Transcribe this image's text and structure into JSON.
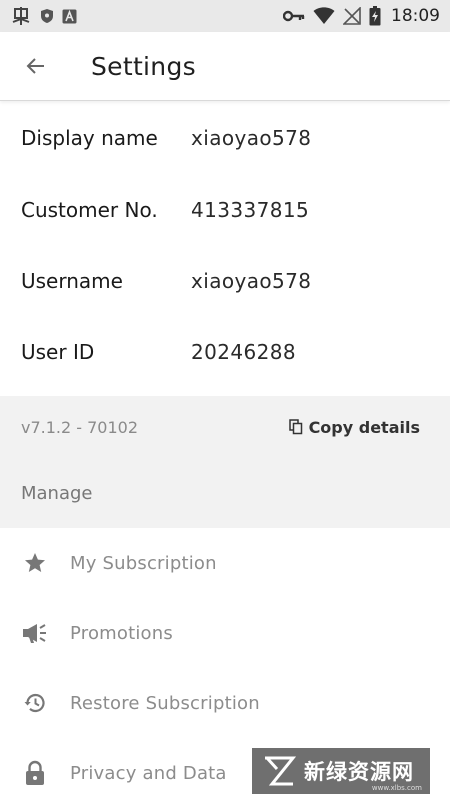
{
  "status_bar": {
    "time": "18:09",
    "icons": [
      "debug-bug-icon",
      "shield-icon",
      "a-letter-icon",
      "key-icon",
      "wifi-icon",
      "no-signal-icon",
      "battery-charging-icon"
    ]
  },
  "app_bar": {
    "back_icon": "arrow-left-icon",
    "title": "Settings"
  },
  "account": [
    {
      "label": "Display name",
      "value": "xiaoyao578"
    },
    {
      "label": "Customer No.",
      "value": "413337815"
    },
    {
      "label": "Username",
      "value": "xiaoyao578"
    },
    {
      "label": "User ID",
      "value": "20246288"
    }
  ],
  "version": {
    "text": "v7.1.2 - 70102",
    "copy_icon": "copy-icon",
    "copy_label": "Copy details"
  },
  "manage": {
    "header": "Manage",
    "items": [
      {
        "icon": "star-icon",
        "label": "My Subscription"
      },
      {
        "icon": "megaphone-icon",
        "label": "Promotions"
      },
      {
        "icon": "restore-history-icon",
        "label": "Restore Subscription"
      },
      {
        "icon": "lock-icon",
        "label": "Privacy and Data"
      }
    ]
  },
  "watermark": {
    "text": "新绿资源网",
    "sub": "www.xlbs.com"
  },
  "colors": {
    "status_bar_bg": "#e9e9e9",
    "grey_block_bg": "#f2f2f2",
    "muted_text": "#8c8c8c"
  }
}
